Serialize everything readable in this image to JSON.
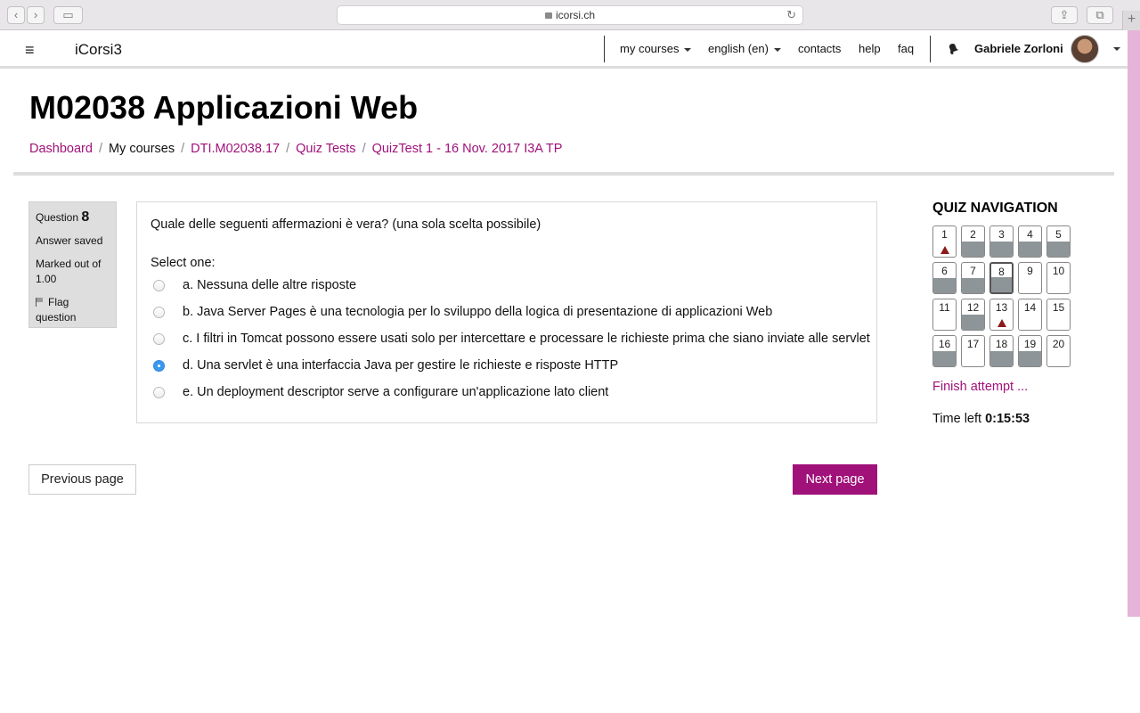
{
  "browser": {
    "url": "icorsi.ch"
  },
  "nav": {
    "brand": "iCorsi3",
    "items": [
      {
        "label": "my courses",
        "dropdown": true
      },
      {
        "label": "english (en)",
        "dropdown": true
      },
      {
        "label": "contacts",
        "dropdown": false
      },
      {
        "label": "help",
        "dropdown": false
      },
      {
        "label": "faq",
        "dropdown": false
      }
    ],
    "user_name": "Gabriele Zorloni"
  },
  "page": {
    "title": "M02038 Applicazioni Web",
    "breadcrumbs": [
      {
        "label": "Dashboard",
        "link": true
      },
      {
        "label": "My courses",
        "link": false
      },
      {
        "label": "DTI.M02038.17",
        "link": true
      },
      {
        "label": "Quiz Tests",
        "link": true
      },
      {
        "label": "QuizTest 1 - 16 Nov. 2017 I3A TP",
        "link": true
      }
    ]
  },
  "question_info": {
    "label": "Question",
    "number": "8",
    "status": "Answer saved",
    "marked_out_of": "Marked out of 1.00",
    "flag_label": "Flag question"
  },
  "question": {
    "text": "Quale delle seguenti affermazioni è vera? (una sola scelta possibile)",
    "prompt": "Select one:",
    "options": [
      {
        "label": "a. Nessuna delle altre risposte",
        "selected": false
      },
      {
        "label": "b. Java Server Pages è una tecnologia per lo sviluppo della logica di presentazione di applicazioni Web",
        "selected": false
      },
      {
        "label": "c. I filtri in Tomcat possono essere usati solo per intercettare e processare le richieste prima che siano inviate alle servlet",
        "selected": false
      },
      {
        "label": "d. Una servlet è una interfaccia Java per gestire le richieste e risposte HTTP",
        "selected": true
      },
      {
        "label": "e. Un deployment descriptor serve a configurare un'applicazione lato client",
        "selected": false
      }
    ]
  },
  "buttons": {
    "previous": "Previous page",
    "next": "Next page"
  },
  "quiz_navigation": {
    "title": "QUIZ NAVIGATION",
    "questions": [
      {
        "n": "1",
        "state": "flagged"
      },
      {
        "n": "2",
        "state": "answered"
      },
      {
        "n": "3",
        "state": "answered"
      },
      {
        "n": "4",
        "state": "answered"
      },
      {
        "n": "5",
        "state": "answered"
      },
      {
        "n": "6",
        "state": "answered"
      },
      {
        "n": "7",
        "state": "answered"
      },
      {
        "n": "8",
        "state": "answered-current"
      },
      {
        "n": "9",
        "state": "empty"
      },
      {
        "n": "10",
        "state": "empty"
      },
      {
        "n": "11",
        "state": "empty"
      },
      {
        "n": "12",
        "state": "answered"
      },
      {
        "n": "13",
        "state": "flagged"
      },
      {
        "n": "14",
        "state": "empty"
      },
      {
        "n": "15",
        "state": "empty"
      },
      {
        "n": "16",
        "state": "answered"
      },
      {
        "n": "17",
        "state": "empty"
      },
      {
        "n": "18",
        "state": "answered"
      },
      {
        "n": "19",
        "state": "answered"
      },
      {
        "n": "20",
        "state": "empty"
      }
    ],
    "finish_label": "Finish attempt ...",
    "time_left_label": "Time left",
    "time_left_value": "0:15:53"
  },
  "colors": {
    "accent": "#a0117a",
    "answered_fill": "#8e9599",
    "flag_red": "#8b1a1a",
    "radio_selected": "#3b97f0"
  }
}
